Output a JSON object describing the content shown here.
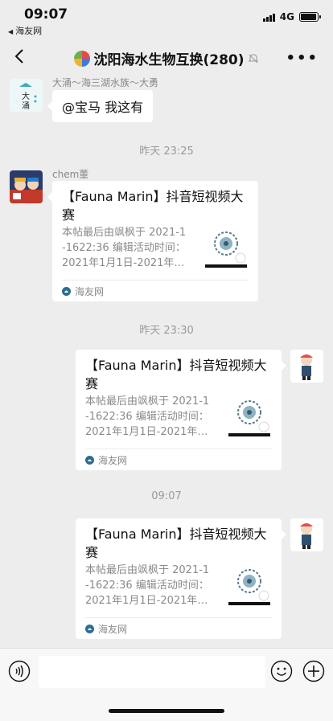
{
  "status_bar": {
    "time": "09:07",
    "back_app": "海友网",
    "network": "4G",
    "battery_level": 0.85
  },
  "nav": {
    "title": "沈阳海水生物互换(280)",
    "icons": [
      "back-arrow-icon",
      "group-avatar-icon",
      "mute-icon",
      "more-icon"
    ]
  },
  "messages": {
    "m1": {
      "sender": "大涌～海三湖水族～大勇",
      "text": "@宝马 我这有",
      "avatar_text_1": "大",
      "avatar_text_2": "涌"
    },
    "time1": "昨天 23:25",
    "m2": {
      "sender": "chem董",
      "card": {
        "title": "【Fauna Marin】抖音短视频大赛",
        "desc_line1": "本帖最后由飒枫于 2021-1",
        "desc_line2": "-1622:36 编辑活动时间：",
        "desc_line3": "2021年1月1日-2021年…",
        "source": "海友网"
      }
    },
    "time2": "昨天 23:30",
    "m3": {
      "card": {
        "title": "【Fauna Marin】抖音短视频大赛",
        "desc_line1": "本帖最后由飒枫于 2021-1",
        "desc_line2": "-1622:36 编辑活动时间：",
        "desc_line3": "2021年1月1日-2021年…",
        "source": "海友网"
      }
    },
    "time3": "09:07",
    "m4": {
      "card": {
        "title": "【Fauna Marin】抖音短视频大赛",
        "desc_line1": "本帖最后由飒枫于 2021-1",
        "desc_line2": "-1622:36 编辑活动时间：",
        "desc_line3": "2021年1月1日-2021年…",
        "source": "海友网"
      }
    }
  },
  "input_bar": {
    "icons": [
      "voice-icon",
      "emoji-icon",
      "plus-icon"
    ],
    "input_value": ""
  },
  "colors": {
    "background": "#ededed",
    "bubble": "#ffffff",
    "meta_text": "#9a9a9a"
  }
}
